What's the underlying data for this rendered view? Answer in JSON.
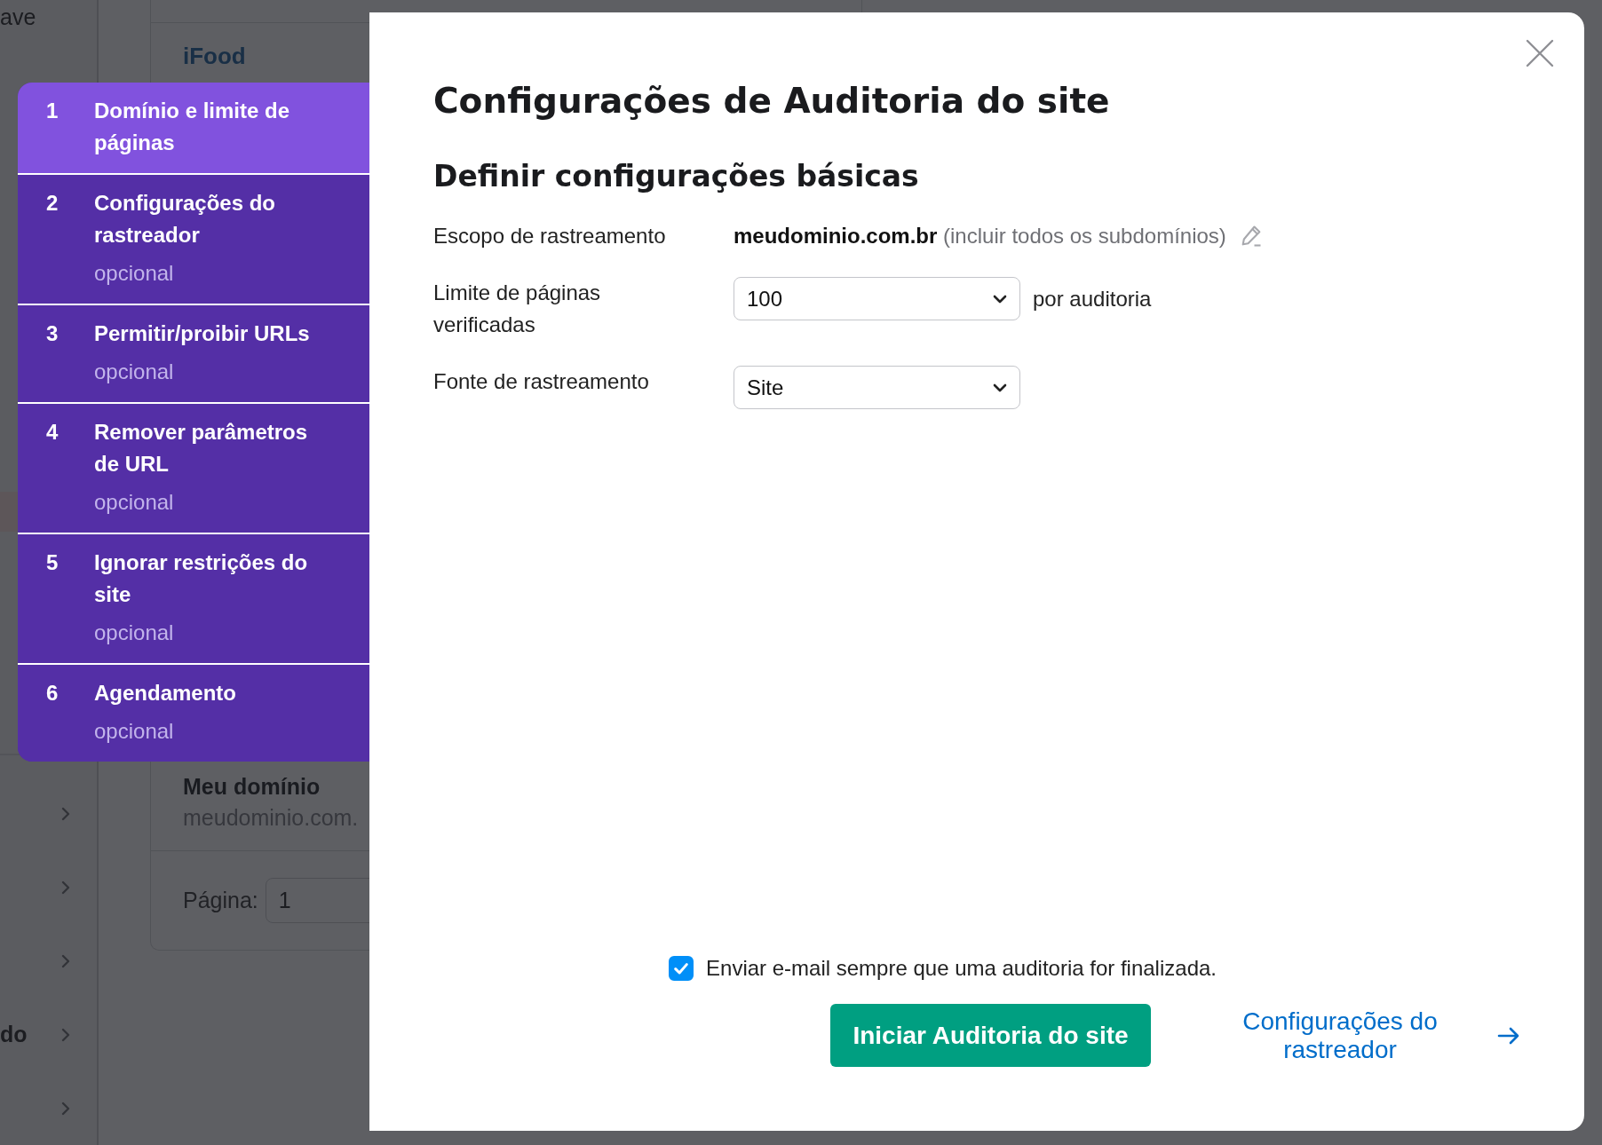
{
  "background": {
    "sidebar": {
      "top_texts": [
        "ave"
      ],
      "rows": [
        {
          "kind": "link"
        },
        {
          "kind": "link"
        },
        {
          "kind": "link"
        },
        {
          "kind": "link",
          "label": "do"
        },
        {
          "kind": "link"
        }
      ]
    },
    "card": {
      "title": "iFood",
      "domain": {
        "name": "Meu domínio",
        "url": "meudominio.com."
      },
      "pager": {
        "label": "Página:",
        "value": "1"
      }
    }
  },
  "steps": [
    {
      "number": "1",
      "title": "Domínio e limite de páginas",
      "selected": true
    },
    {
      "number": "2",
      "title": "Configurações do rastreador",
      "note": "opcional",
      "selected": false
    },
    {
      "number": "3",
      "title": "Permitir/proibir URLs",
      "note": "opcional",
      "selected": false
    },
    {
      "number": "4",
      "title": "Remover parâmetros de URL",
      "note": "opcional",
      "selected": false
    },
    {
      "number": "5",
      "title": "Ignorar restrições do site",
      "note": "opcional",
      "selected": false
    },
    {
      "number": "6",
      "title": "Agendamento",
      "note": "opcional",
      "selected": false
    }
  ],
  "modal": {
    "title": "Configurações de Auditoria do site",
    "subtitle": "Definir configurações básicas",
    "fields": [
      {
        "kind": "text",
        "label": "Escopo de rastreamento",
        "value": "meudominio.com.br",
        "hint": "(incluir todos os subdomínios)"
      },
      {
        "kind": "select",
        "label": "Limite de páginas verificadas",
        "value": "100",
        "suffix": "por auditoria"
      },
      {
        "kind": "select",
        "label": "Fonte de rastreamento",
        "value": "Site"
      }
    ],
    "email_checkbox": {
      "label": "Enviar e-mail sempre que uma auditoria for finalizada.",
      "checked": true
    },
    "primary_button": "Iniciar Auditoria do site",
    "next_link": "Configurações do rastreador"
  }
}
